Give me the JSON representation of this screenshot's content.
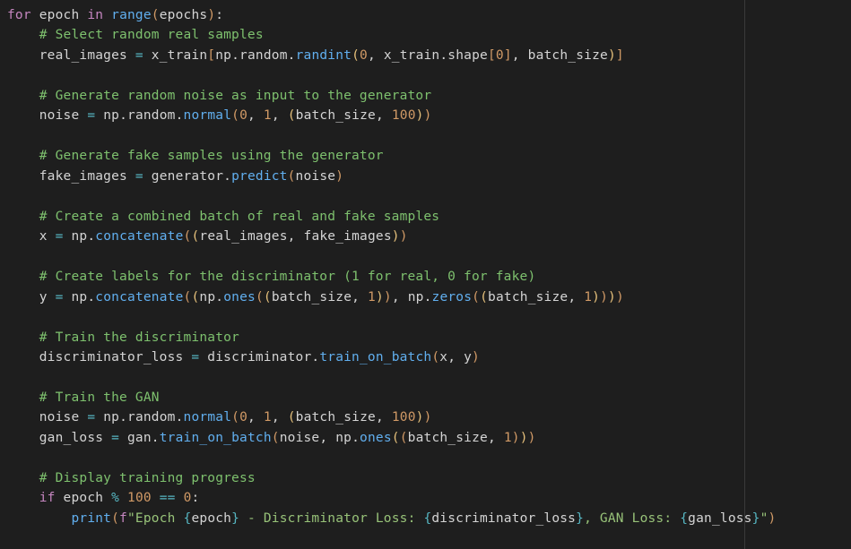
{
  "code": {
    "l01": {
      "kw_for": "for",
      "sp1": " ",
      "v_epoch": "epoch",
      "sp2": " ",
      "kw_in": "in",
      "sp3": " ",
      "fn_range": "range",
      "lp": "(",
      "v_epochs": "epochs",
      "rp": ")",
      "colon": ":"
    },
    "l02": {
      "indent": "    ",
      "cmt": "# Select random real samples"
    },
    "l03": {
      "indent": "    ",
      "v_real": "real_images",
      "sp1": " ",
      "op_eq": "=",
      "sp2": " ",
      "v_xtrain": "x_train",
      "lb": "[",
      "v_np": "np",
      "d1": ".",
      "v_rand": "random",
      "d2": ".",
      "fn_randint": "randint",
      "lp": "(",
      "n0": "0",
      "c1": ", ",
      "v_xtrain2": "x_train",
      "d3": ".",
      "v_shape": "shape",
      "lb2": "[",
      "n0b": "0",
      "rb2": "]",
      "c2": ", ",
      "v_bs": "batch_size",
      "rp": ")",
      "rb": "]"
    },
    "l05": {
      "indent": "    ",
      "cmt": "# Generate random noise as input to the generator"
    },
    "l06": {
      "indent": "    ",
      "v_noise": "noise",
      "sp1": " ",
      "op_eq": "=",
      "sp2": " ",
      "v_np": "np",
      "d1": ".",
      "v_rand": "random",
      "d2": ".",
      "fn_normal": "normal",
      "lp": "(",
      "n0": "0",
      "c1": ", ",
      "n1": "1",
      "c2": ", ",
      "lp2": "(",
      "v_bs": "batch_size",
      "c3": ", ",
      "n100": "100",
      "rp2": ")",
      "rp": ")"
    },
    "l08": {
      "indent": "    ",
      "cmt": "# Generate fake samples using the generator"
    },
    "l09": {
      "indent": "    ",
      "v_fake": "fake_images",
      "sp1": " ",
      "op_eq": "=",
      "sp2": " ",
      "v_gen": "generator",
      "d1": ".",
      "fn_pred": "predict",
      "lp": "(",
      "v_noise": "noise",
      "rp": ")"
    },
    "l11": {
      "indent": "    ",
      "cmt": "# Create a combined batch of real and fake samples"
    },
    "l12": {
      "indent": "    ",
      "v_x": "x",
      "sp1": " ",
      "op_eq": "=",
      "sp2": " ",
      "v_np": "np",
      "d1": ".",
      "fn_conc": "concatenate",
      "lp": "(",
      "lp2": "(",
      "v_real": "real_images",
      "c1": ", ",
      "v_fake": "fake_images",
      "rp2": ")",
      "rp": ")"
    },
    "l14": {
      "indent": "    ",
      "cmt": "# Create labels for the discriminator (1 for real, 0 for fake)"
    },
    "l15": {
      "indent": "    ",
      "v_y": "y",
      "sp1": " ",
      "op_eq": "=",
      "sp2": " ",
      "v_np": "np",
      "d1": ".",
      "fn_conc": "concatenate",
      "lp": "(",
      "lp2": "(",
      "v_np2": "np",
      "d2": ".",
      "fn_ones": "ones",
      "lp3": "(",
      "lp4": "(",
      "v_bs1": "batch_size",
      "c1": ", ",
      "n1a": "1",
      "rp4": ")",
      "rp3": ")",
      "c2": ", ",
      "v_np3": "np",
      "d3": ".",
      "fn_zeros": "zeros",
      "lp5": "(",
      "lp6": "(",
      "v_bs2": "batch_size",
      "c3": ", ",
      "n1b": "1",
      "rp6": ")",
      "rp5": ")",
      "rp2": ")",
      "rp": ")"
    },
    "l17": {
      "indent": "    ",
      "cmt": "# Train the discriminator"
    },
    "l18": {
      "indent": "    ",
      "v_dl": "discriminator_loss",
      "sp1": " ",
      "op_eq": "=",
      "sp2": " ",
      "v_disc": "discriminator",
      "d1": ".",
      "fn_tob": "train_on_batch",
      "lp": "(",
      "v_x": "x",
      "c1": ", ",
      "v_y": "y",
      "rp": ")"
    },
    "l20": {
      "indent": "    ",
      "cmt": "# Train the GAN"
    },
    "l21": {
      "indent": "    ",
      "v_noise": "noise",
      "sp1": " ",
      "op_eq": "=",
      "sp2": " ",
      "v_np": "np",
      "d1": ".",
      "v_rand": "random",
      "d2": ".",
      "fn_normal": "normal",
      "lp": "(",
      "n0": "0",
      "c1": ", ",
      "n1": "1",
      "c2": ", ",
      "lp2": "(",
      "v_bs": "batch_size",
      "c3": ", ",
      "n100": "100",
      "rp2": ")",
      "rp": ")"
    },
    "l22": {
      "indent": "    ",
      "v_gl": "gan_loss",
      "sp1": " ",
      "op_eq": "=",
      "sp2": " ",
      "v_gan": "gan",
      "d1": ".",
      "fn_tob": "train_on_batch",
      "lp": "(",
      "v_noise": "noise",
      "c1": ", ",
      "v_np": "np",
      "d2": ".",
      "fn_ones": "ones",
      "lp2": "(",
      "lp3": "(",
      "v_bs": "batch_size",
      "c2": ", ",
      "n1b": "1",
      "rp3": ")",
      "rp2": ")",
      "rp": ")"
    },
    "l24": {
      "indent": "    ",
      "cmt": "# Display training progress"
    },
    "l25": {
      "indent": "    ",
      "kw_if": "if",
      "sp1": " ",
      "v_epoch": "epoch",
      "sp2": " ",
      "op_mod": "%",
      "sp3": " ",
      "n100": "100",
      "sp4": " ",
      "op_eq": "==",
      "sp5": " ",
      "n0": "0",
      "colon": ":"
    },
    "l26": {
      "indent": "        ",
      "fn_print": "print",
      "lp": "(",
      "f_pre": "f",
      "q1": "\"",
      "s1": "Epoch ",
      "b1": "{",
      "fv1": "epoch",
      "b2": "}",
      "s2": " - Discriminator Loss: ",
      "b3": "{",
      "fv2": "discriminator_loss",
      "b4": "}",
      "s3": ", GAN Loss: ",
      "b5": "{",
      "fv3": "gan_loss",
      "b6": "}",
      "q2": "\"",
      "rp": ")"
    }
  }
}
